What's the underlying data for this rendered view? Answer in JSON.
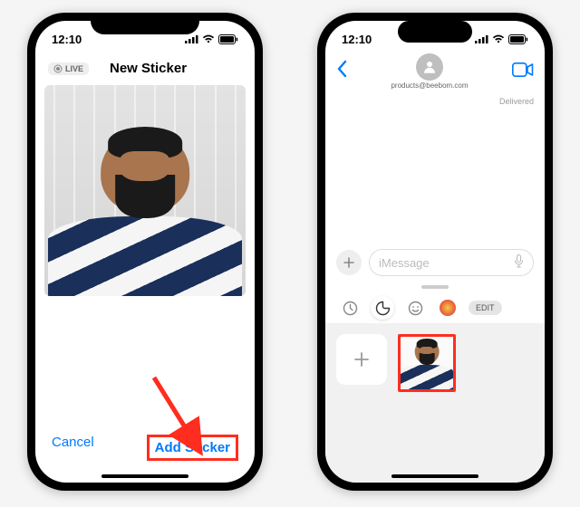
{
  "left": {
    "status": {
      "time": "12:10"
    },
    "live_badge": "LIVE",
    "title": "New Sticker",
    "cancel_label": "Cancel",
    "add_label": "Add Sticker"
  },
  "right": {
    "status": {
      "time": "12:10"
    },
    "contact_email": "products@beebom.com",
    "delivered_label": "Delivered",
    "input_placeholder": "iMessage",
    "edit_label": "EDIT"
  },
  "colors": {
    "ios_blue": "#007aff",
    "highlight": "#ff2d1f"
  }
}
